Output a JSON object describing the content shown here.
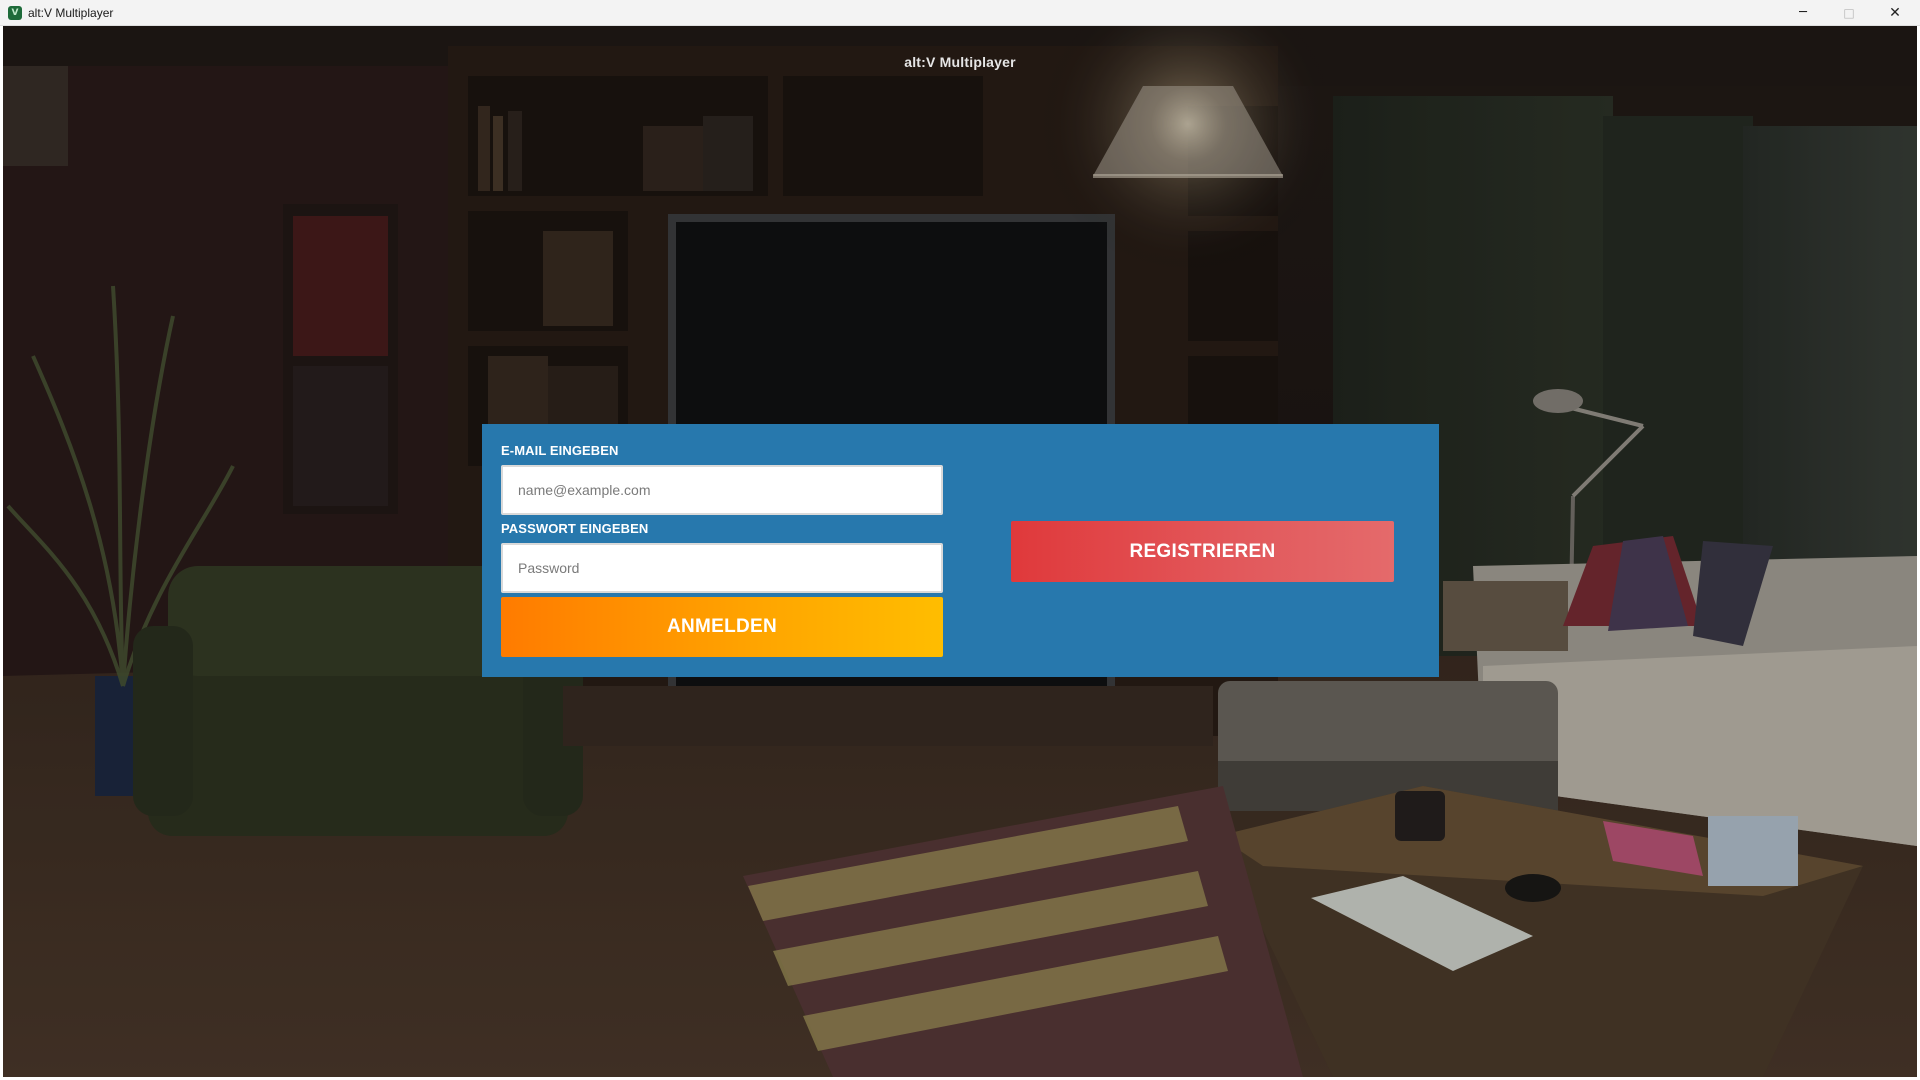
{
  "window": {
    "title": "alt:V Multiplayer",
    "icon": "altv-logo-icon",
    "icon_glyph": "V",
    "controls": {
      "minimize": "─",
      "maximize": "□",
      "close": "✕"
    }
  },
  "overlay": {
    "title": "alt:V Multiplayer"
  },
  "login": {
    "email_label": "E-MAIL EINGEBEN",
    "email_placeholder": "name@example.com",
    "email_value": "",
    "password_label": "PASSWORT EINGEBEN",
    "password_placeholder": "Password",
    "password_value": "",
    "login_button": "ANMELDEN",
    "register_button": "REGISTRIEREN"
  },
  "colors": {
    "panel": "#2778ad",
    "login_gradient_start": "#ff7b00",
    "login_gradient_end": "#ffbd00",
    "register_gradient_start": "#e0393b",
    "register_gradient_end": "#e46a6b"
  }
}
